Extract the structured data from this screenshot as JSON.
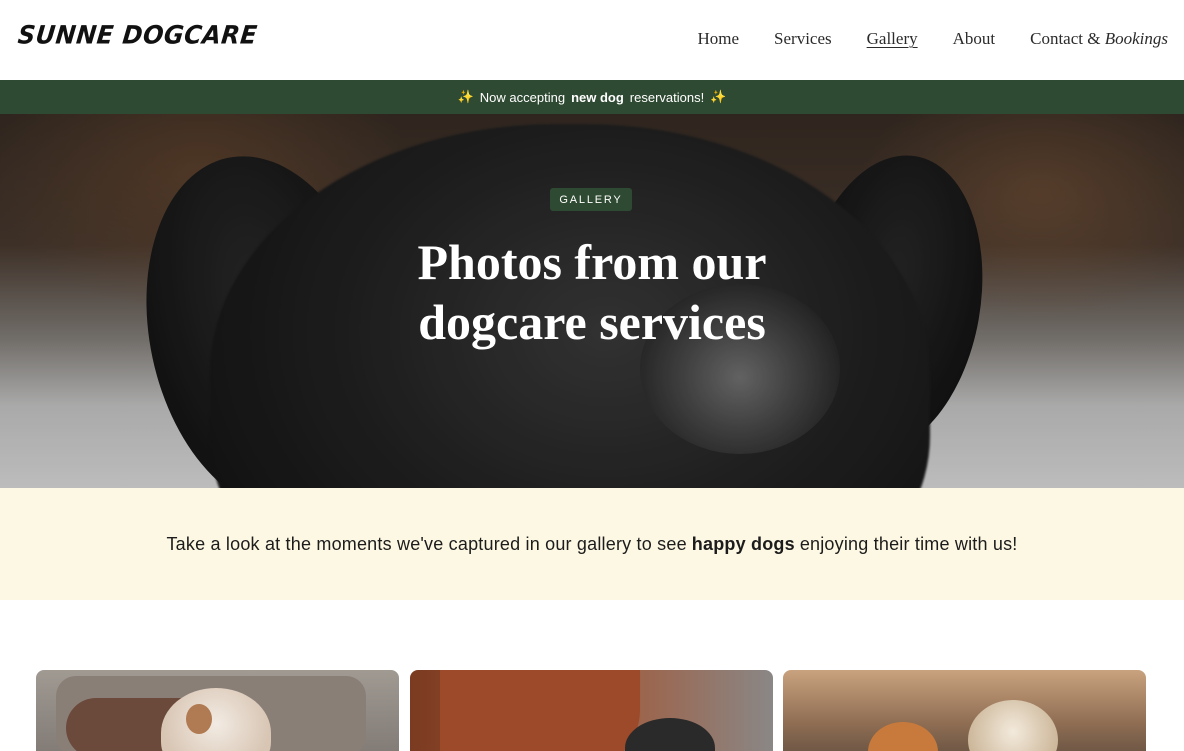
{
  "header": {
    "logo": "Sunne Dogcare",
    "nav": [
      {
        "label": "Home"
      },
      {
        "label": "Services"
      },
      {
        "label": "Gallery",
        "active": true
      },
      {
        "label": "About"
      },
      {
        "label": "Contact & ",
        "label_em": "Bookings"
      }
    ]
  },
  "announcement": {
    "prefix": "Now accepting",
    "bold": "new dog",
    "suffix": "reservations!",
    "icon": "sparkles-icon",
    "color": "#2f4a32"
  },
  "hero": {
    "badge": "GALLERY",
    "title": "Photos from our dogcare services"
  },
  "intro": {
    "prefix": "Take a look at the moments we've captured in our gallery to see",
    "bold": "happy dogs",
    "suffix": "enjoying their time with us!",
    "background": "#fdf8e3"
  },
  "gallery": {
    "cards": [
      {
        "name": "gallery-card-1"
      },
      {
        "name": "gallery-card-2"
      },
      {
        "name": "gallery-card-3"
      }
    ]
  }
}
